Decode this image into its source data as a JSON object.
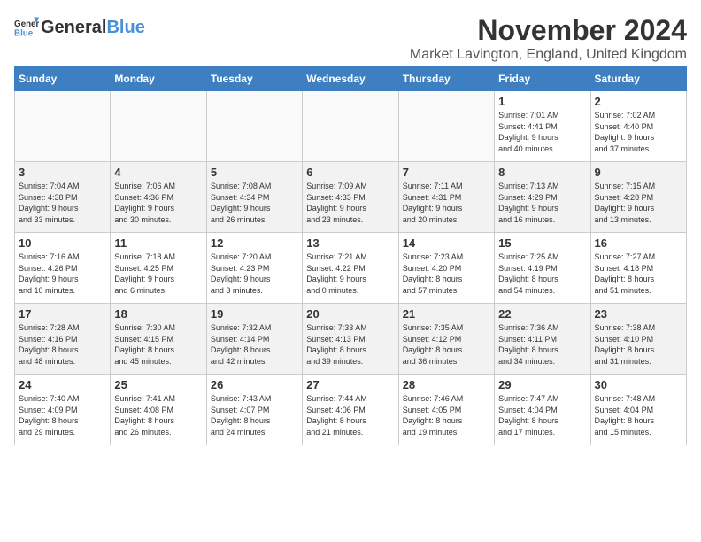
{
  "header": {
    "logo_general": "General",
    "logo_blue": "Blue",
    "month_title": "November 2024",
    "location": "Market Lavington, England, United Kingdom"
  },
  "days_of_week": [
    "Sunday",
    "Monday",
    "Tuesday",
    "Wednesday",
    "Thursday",
    "Friday",
    "Saturday"
  ],
  "weeks": [
    {
      "band": "row-band-1",
      "days": [
        {
          "num": "",
          "info": "",
          "empty": true
        },
        {
          "num": "",
          "info": "",
          "empty": true
        },
        {
          "num": "",
          "info": "",
          "empty": true
        },
        {
          "num": "",
          "info": "",
          "empty": true
        },
        {
          "num": "",
          "info": "",
          "empty": true
        },
        {
          "num": "1",
          "info": "Sunrise: 7:01 AM\nSunset: 4:41 PM\nDaylight: 9 hours\nand 40 minutes.",
          "empty": false
        },
        {
          "num": "2",
          "info": "Sunrise: 7:02 AM\nSunset: 4:40 PM\nDaylight: 9 hours\nand 37 minutes.",
          "empty": false
        }
      ]
    },
    {
      "band": "row-band-2",
      "days": [
        {
          "num": "3",
          "info": "Sunrise: 7:04 AM\nSunset: 4:38 PM\nDaylight: 9 hours\nand 33 minutes.",
          "empty": false
        },
        {
          "num": "4",
          "info": "Sunrise: 7:06 AM\nSunset: 4:36 PM\nDaylight: 9 hours\nand 30 minutes.",
          "empty": false
        },
        {
          "num": "5",
          "info": "Sunrise: 7:08 AM\nSunset: 4:34 PM\nDaylight: 9 hours\nand 26 minutes.",
          "empty": false
        },
        {
          "num": "6",
          "info": "Sunrise: 7:09 AM\nSunset: 4:33 PM\nDaylight: 9 hours\nand 23 minutes.",
          "empty": false
        },
        {
          "num": "7",
          "info": "Sunrise: 7:11 AM\nSunset: 4:31 PM\nDaylight: 9 hours\nand 20 minutes.",
          "empty": false
        },
        {
          "num": "8",
          "info": "Sunrise: 7:13 AM\nSunset: 4:29 PM\nDaylight: 9 hours\nand 16 minutes.",
          "empty": false
        },
        {
          "num": "9",
          "info": "Sunrise: 7:15 AM\nSunset: 4:28 PM\nDaylight: 9 hours\nand 13 minutes.",
          "empty": false
        }
      ]
    },
    {
      "band": "row-band-1",
      "days": [
        {
          "num": "10",
          "info": "Sunrise: 7:16 AM\nSunset: 4:26 PM\nDaylight: 9 hours\nand 10 minutes.",
          "empty": false
        },
        {
          "num": "11",
          "info": "Sunrise: 7:18 AM\nSunset: 4:25 PM\nDaylight: 9 hours\nand 6 minutes.",
          "empty": false
        },
        {
          "num": "12",
          "info": "Sunrise: 7:20 AM\nSunset: 4:23 PM\nDaylight: 9 hours\nand 3 minutes.",
          "empty": false
        },
        {
          "num": "13",
          "info": "Sunrise: 7:21 AM\nSunset: 4:22 PM\nDaylight: 9 hours\nand 0 minutes.",
          "empty": false
        },
        {
          "num": "14",
          "info": "Sunrise: 7:23 AM\nSunset: 4:20 PM\nDaylight: 8 hours\nand 57 minutes.",
          "empty": false
        },
        {
          "num": "15",
          "info": "Sunrise: 7:25 AM\nSunset: 4:19 PM\nDaylight: 8 hours\nand 54 minutes.",
          "empty": false
        },
        {
          "num": "16",
          "info": "Sunrise: 7:27 AM\nSunset: 4:18 PM\nDaylight: 8 hours\nand 51 minutes.",
          "empty": false
        }
      ]
    },
    {
      "band": "row-band-2",
      "days": [
        {
          "num": "17",
          "info": "Sunrise: 7:28 AM\nSunset: 4:16 PM\nDaylight: 8 hours\nand 48 minutes.",
          "empty": false
        },
        {
          "num": "18",
          "info": "Sunrise: 7:30 AM\nSunset: 4:15 PM\nDaylight: 8 hours\nand 45 minutes.",
          "empty": false
        },
        {
          "num": "19",
          "info": "Sunrise: 7:32 AM\nSunset: 4:14 PM\nDaylight: 8 hours\nand 42 minutes.",
          "empty": false
        },
        {
          "num": "20",
          "info": "Sunrise: 7:33 AM\nSunset: 4:13 PM\nDaylight: 8 hours\nand 39 minutes.",
          "empty": false
        },
        {
          "num": "21",
          "info": "Sunrise: 7:35 AM\nSunset: 4:12 PM\nDaylight: 8 hours\nand 36 minutes.",
          "empty": false
        },
        {
          "num": "22",
          "info": "Sunrise: 7:36 AM\nSunset: 4:11 PM\nDaylight: 8 hours\nand 34 minutes.",
          "empty": false
        },
        {
          "num": "23",
          "info": "Sunrise: 7:38 AM\nSunset: 4:10 PM\nDaylight: 8 hours\nand 31 minutes.",
          "empty": false
        }
      ]
    },
    {
      "band": "row-band-1",
      "days": [
        {
          "num": "24",
          "info": "Sunrise: 7:40 AM\nSunset: 4:09 PM\nDaylight: 8 hours\nand 29 minutes.",
          "empty": false
        },
        {
          "num": "25",
          "info": "Sunrise: 7:41 AM\nSunset: 4:08 PM\nDaylight: 8 hours\nand 26 minutes.",
          "empty": false
        },
        {
          "num": "26",
          "info": "Sunrise: 7:43 AM\nSunset: 4:07 PM\nDaylight: 8 hours\nand 24 minutes.",
          "empty": false
        },
        {
          "num": "27",
          "info": "Sunrise: 7:44 AM\nSunset: 4:06 PM\nDaylight: 8 hours\nand 21 minutes.",
          "empty": false
        },
        {
          "num": "28",
          "info": "Sunrise: 7:46 AM\nSunset: 4:05 PM\nDaylight: 8 hours\nand 19 minutes.",
          "empty": false
        },
        {
          "num": "29",
          "info": "Sunrise: 7:47 AM\nSunset: 4:04 PM\nDaylight: 8 hours\nand 17 minutes.",
          "empty": false
        },
        {
          "num": "30",
          "info": "Sunrise: 7:48 AM\nSunset: 4:04 PM\nDaylight: 8 hours\nand 15 minutes.",
          "empty": false
        }
      ]
    }
  ]
}
